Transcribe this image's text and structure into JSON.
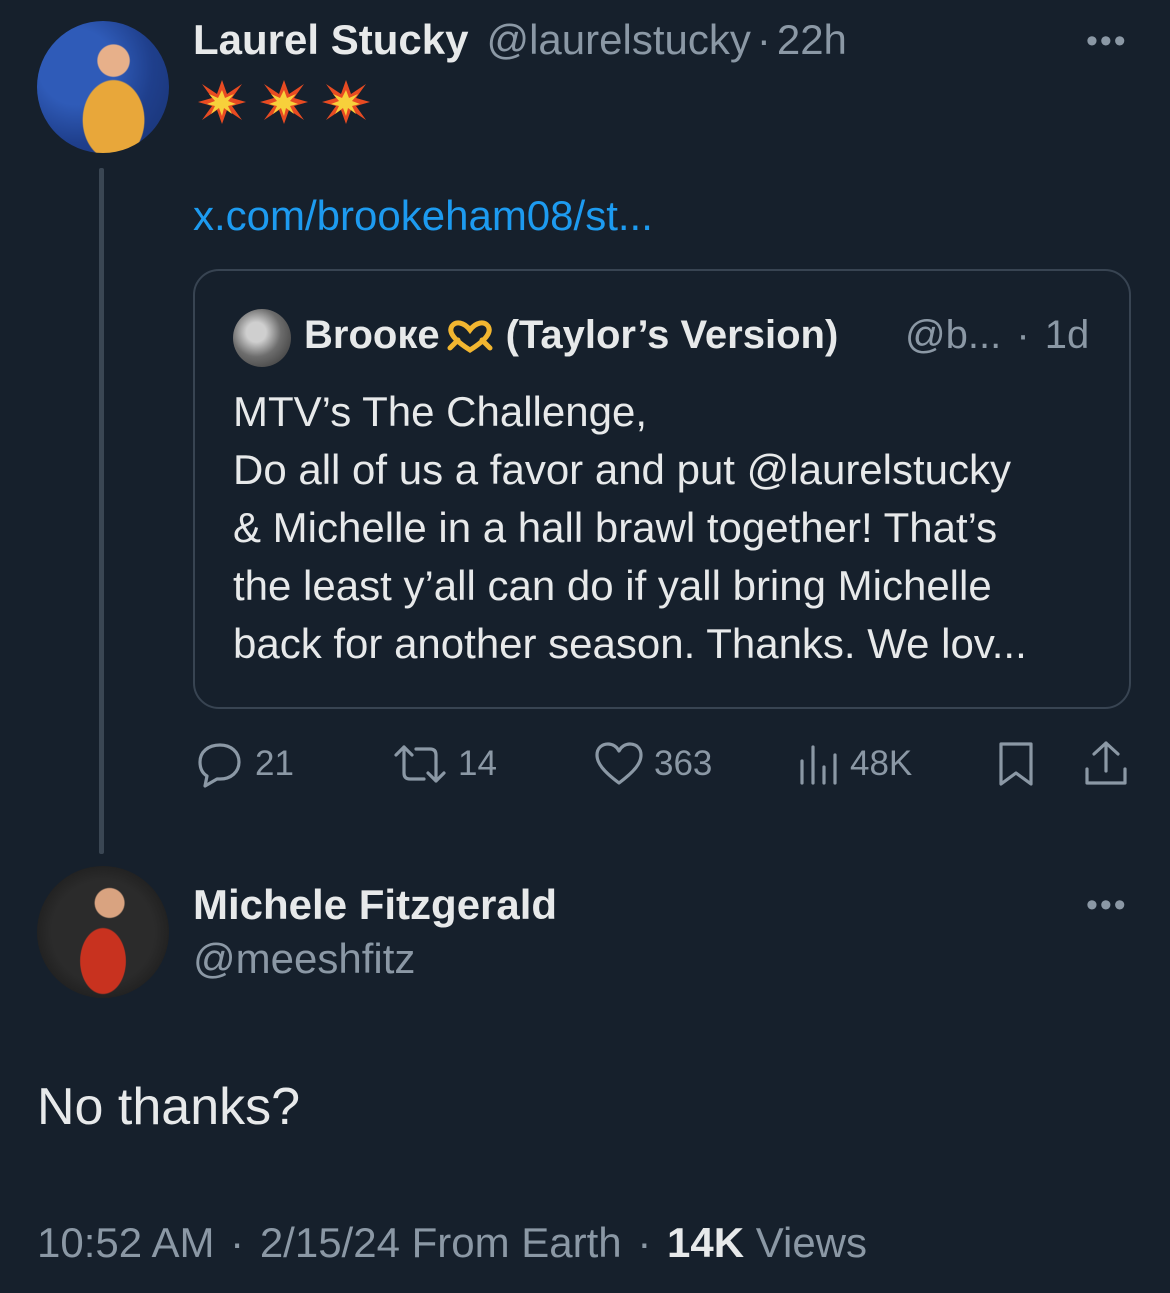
{
  "tweet": {
    "author_name": "Laurel Stucky",
    "author_handle": "@laurelstucky",
    "separator": "·",
    "time": "22h",
    "more": "•••",
    "emoji_icons": [
      "collision-icon",
      "collision-icon",
      "collision-icon"
    ],
    "link": "x.com/brookeham08/st...",
    "quote": {
      "author_name": "Вrooкe",
      "author_emoji": "heart-hands-icon",
      "author_suffix": "(Taylor’s Version)",
      "author_handle": "@b...",
      "separator": "·",
      "time": "1d",
      "text_lines": [
        "MTV’s The Challenge,",
        "Do all of us a favor and put @laurelstucky",
        "& Michelle in a hall brawl together! That’s",
        "the least y’all can do if yall bring Michelle",
        "back for another season. Thanks. We lov..."
      ]
    },
    "actions": {
      "replies": "21",
      "reposts": "14",
      "likes": "363",
      "views": "48K"
    }
  },
  "reply": {
    "author_name": "Michele Fitzgerald",
    "author_handle": "@meeshfitz",
    "more": "•••",
    "text": "No thanks?",
    "meta": {
      "time": "10:52 AM",
      "separator": "·",
      "date_source": "2/15/24 From Earth",
      "views_count": "14K",
      "views_label": "Views"
    }
  },
  "colors": {
    "background": "#16202c",
    "text": "#e7e9ea",
    "muted": "#8b98a5",
    "link": "#1d9bf0",
    "border": "#384452"
  }
}
